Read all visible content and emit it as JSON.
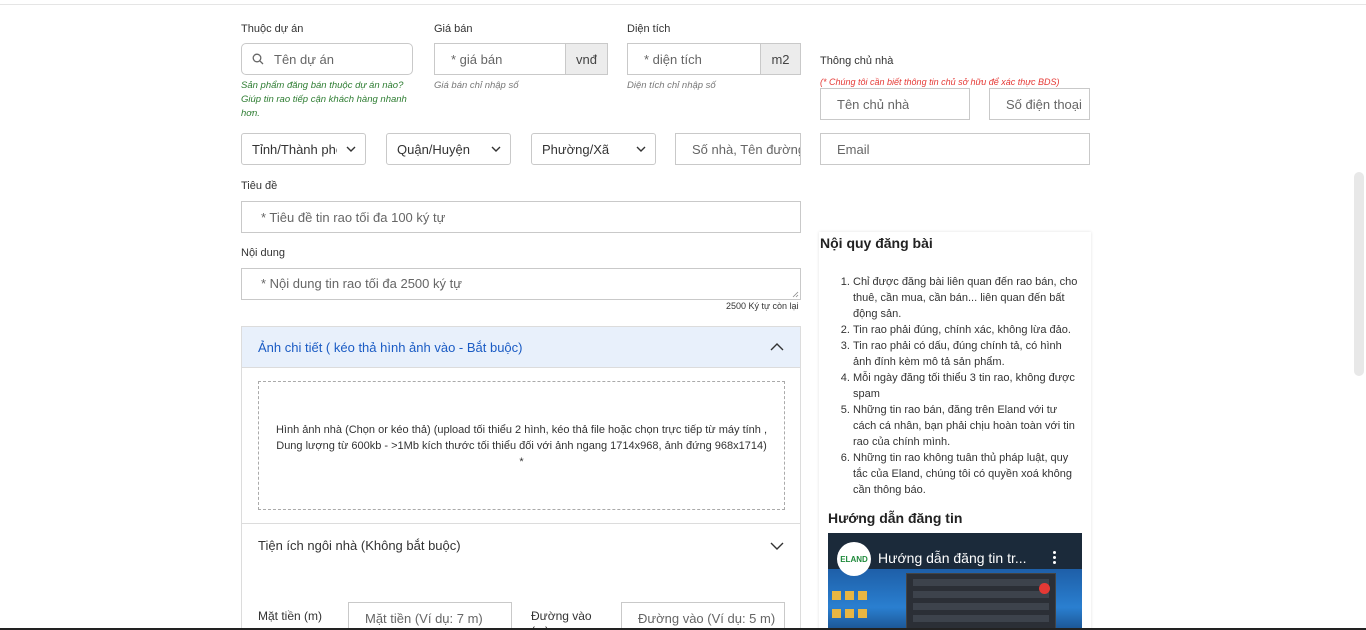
{
  "project": {
    "label": "Thuộc dự án",
    "placeholder": "Tên dự án",
    "hint": "Sản phẩm đăng bán thuộc dự án nào? Giúp tin rao tiếp cận khách hàng nhanh hơn."
  },
  "price": {
    "label": "Giá bán",
    "placeholder": "* giá bán",
    "unit": "vnđ",
    "hint": "Giá bán chỉ nhập số"
  },
  "area": {
    "label": "Diện tích",
    "placeholder": "* diện tích",
    "unit": "m2",
    "hint": "Diện tích chỉ nhập số"
  },
  "owner": {
    "label": "Thông chủ nhà",
    "note": "(* Chúng tôi cần biết thông tin chủ sở hữu để xác thực BDS)",
    "name_placeholder": "Tên chủ nhà",
    "phone_placeholder": "Số điện thoại",
    "email_placeholder": "Email"
  },
  "location": {
    "province": "Tỉnh/Thành phố",
    "district": "Quận/Huyện",
    "ward": "Phường/Xã",
    "street_placeholder": "Số nhà, Tên đường"
  },
  "title_field": {
    "label": "Tiêu đề",
    "placeholder": "* Tiêu đề tin rao tối đa 100 ký tự"
  },
  "content_field": {
    "label": "Nội dung",
    "placeholder": "* Nội dung tin rao tối đa 2500 ký tự",
    "counter": "2500 Ký tự còn lại"
  },
  "photos": {
    "header": "Ảnh chi tiết ( kéo thả hình ảnh vào - Bắt buộc)",
    "drop_text": "Hình ảnh nhà (Chọn or kéo thả) (upload tối thiểu 2 hình, kéo thả file hoặc chọn trực tiếp từ máy tính , Dung lượng từ 600kb - >1Mb kích thước tối thiểu đối với ảnh ngang 1714x968, ảnh đứng 968x1714) *"
  },
  "amenities": {
    "header": "Tiện ích ngôi nhà (Không bắt buộc)",
    "frontage_label": "Mặt tiền (m)",
    "frontage_placeholder": "Mặt tiền (Ví dụ: 7 m)",
    "road_label": "Đường vào (m)",
    "road_placeholder": "Đường vào (Ví dụ: 5 m)"
  },
  "rules": {
    "title": "Nội quy đăng bài",
    "items": [
      "Chỉ được đăng bài liên quan đến rao bán, cho thuê, cần mua, cần bán... liên quan đến bất động sản.",
      "Tin rao phải đúng, chính xác, không lừa đảo.",
      "Tin rao phải có dấu, đúng chính tả, có hình ảnh đính kèm mô tả sản phẩm.",
      "Mỗi ngày đăng tối thiểu 3 tin rao, không được spam",
      "Những tin rao bán, đăng trên Eland với tư cách cá nhân, bạn phải chịu hoàn toàn với tin rao của chính mình.",
      "Những tin rao không tuân thủ pháp luật, quy tắc của Eland, chúng tôi có quyền xoá không cần thông báo."
    ],
    "guide_title": "Hướng dẫn đăng tin",
    "video_title": "Hướng dẫn đăng tin tr...",
    "video_logo": "ELAND"
  }
}
